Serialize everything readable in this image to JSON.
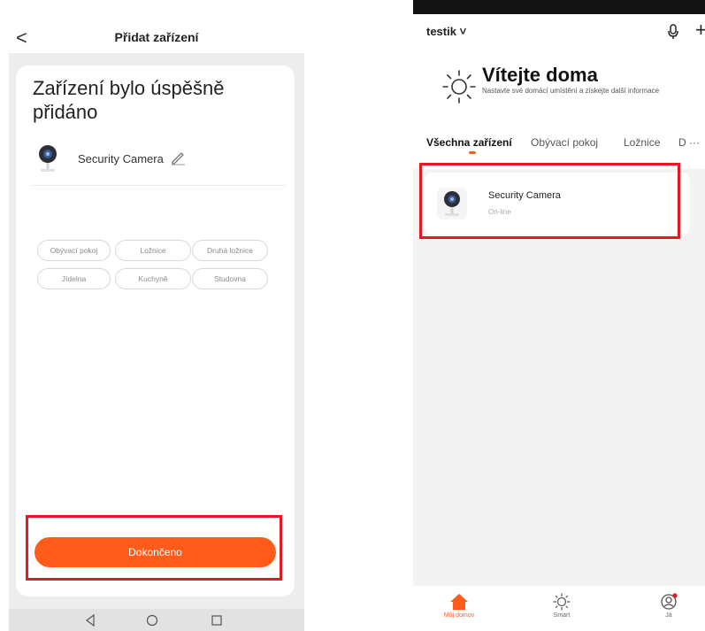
{
  "add_device_screen": {
    "back_glyph": "<",
    "title": "Přidat zařízení",
    "success_message": "Zařízení bylo úspěšně přidáno",
    "device_name": "Security Camera",
    "rooms": [
      "Obývací pokoj",
      "Ložnice",
      "Druhá ložnice",
      "Jídelna",
      "Kuchyně",
      "Studovna"
    ],
    "done_button": "Dokončeno",
    "accent_color": "#ff5b1a",
    "highlight_color": "#e01b24"
  },
  "home_screen": {
    "home_name": "testik ˅",
    "plus_glyph": "+",
    "welcome_title": "Vítejte doma",
    "welcome_subtitle": "Nastavte své domácí umístění a získejte další informace",
    "tabs": [
      "Všechna zařízení",
      "Obývací pokoj",
      "Ložnice",
      "D ···"
    ],
    "device": {
      "name": "Security Camera",
      "status": "On-line"
    },
    "bottom_nav": [
      "Můj domov",
      "Smart",
      "Já"
    ],
    "icons": [
      "microphone-icon",
      "plus-icon",
      "sun-icon",
      "camera-icon",
      "home-icon",
      "smart-icon",
      "profile-icon"
    ]
  }
}
